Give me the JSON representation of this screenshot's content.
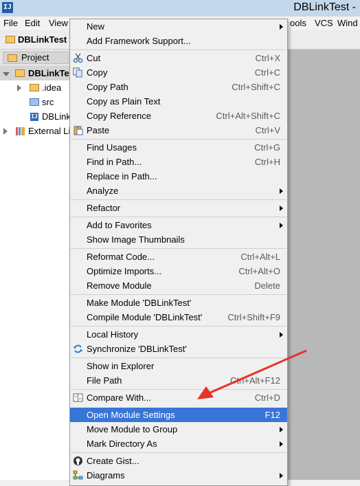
{
  "window": {
    "logo": "IJ",
    "title": "DBLinkTest -"
  },
  "menubar": {
    "file": "File",
    "edit": "Edit",
    "view": "View",
    "tools": "ools",
    "vcs": "VCS",
    "window": "Wind"
  },
  "toolbar": {
    "breadcrumb": "DBLinkTest"
  },
  "panel": {
    "tab_label": "Project"
  },
  "tree": {
    "root": "DBLinkTe",
    "idea": ".idea",
    "src": "src",
    "iml": "DBLink",
    "external": "External Li"
  },
  "context_menu": {
    "new": "New",
    "add_framework": "Add Framework Support...",
    "cut": "Cut",
    "cut_sc": "Ctrl+X",
    "copy": "Copy",
    "copy_sc": "Ctrl+C",
    "copy_path": "Copy Path",
    "copy_path_sc": "Ctrl+Shift+C",
    "copy_plain": "Copy as Plain Text",
    "copy_ref": "Copy Reference",
    "copy_ref_sc": "Ctrl+Alt+Shift+C",
    "paste": "Paste",
    "paste_sc": "Ctrl+V",
    "find_usages": "Find Usages",
    "find_usages_sc": "Ctrl+G",
    "find_path": "Find in Path...",
    "find_path_sc": "Ctrl+H",
    "replace_path": "Replace in Path...",
    "analyze": "Analyze",
    "refactor": "Refactor",
    "add_fav": "Add to Favorites",
    "show_thumbs": "Show Image Thumbnails",
    "reformat": "Reformat Code...",
    "reformat_sc": "Ctrl+Alt+L",
    "optimize": "Optimize Imports...",
    "optimize_sc": "Ctrl+Alt+O",
    "remove_module": "Remove Module",
    "remove_module_sc": "Delete",
    "make_module": "Make Module 'DBLinkTest'",
    "compile_module": "Compile Module 'DBLinkTest'",
    "compile_module_sc": "Ctrl+Shift+F9",
    "local_history": "Local History",
    "synchronize": "Synchronize 'DBLinkTest'",
    "show_explorer": "Show in Explorer",
    "file_path": "File Path",
    "file_path_sc": "Ctrl+Alt+F12",
    "compare": "Compare With...",
    "compare_sc": "Ctrl+D",
    "open_settings": "Open Module Settings",
    "open_settings_sc": "F12",
    "move_group": "Move Module to Group",
    "mark_dir": "Mark Directory As",
    "create_gist": "Create Gist...",
    "diagrams": "Diagrams"
  },
  "colors": {
    "highlight": "#3875d7",
    "annotation_arrow": "#e8312a"
  }
}
